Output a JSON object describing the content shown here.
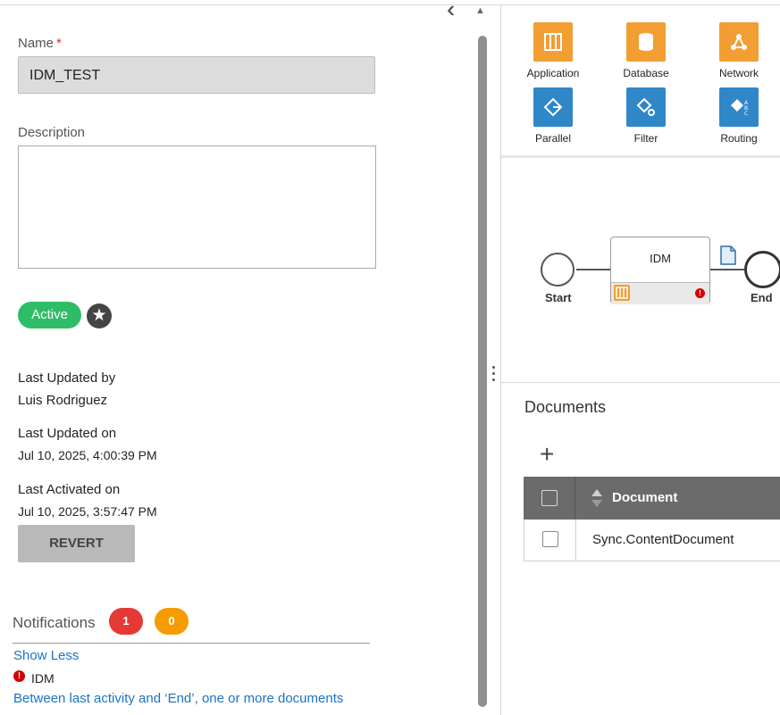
{
  "form": {
    "name_label": "Name",
    "required_mark": "*",
    "name_value": "IDM_TEST",
    "description_label": "Description",
    "description_value": "",
    "status": "Active",
    "last_updated_by_label": "Last Updated by",
    "last_updated_by": "Luis Rodriguez",
    "last_updated_on_label": "Last Updated on",
    "last_updated_on": "Jul 10, 2025, 4:00:39 PM",
    "last_activated_on_label": "Last Activated on",
    "last_activated_on": "Jul 10, 2025, 3:57:47 PM",
    "revert_label": "REVERT"
  },
  "notifications": {
    "title": "Notifications",
    "error_count": "1",
    "warning_count": "0",
    "show_less": "Show Less",
    "item_name": "IDM",
    "item_message": "Between last activity and ‘End’, one or more documents"
  },
  "palette": {
    "items": [
      {
        "label": "Application",
        "icon": "application-icon",
        "color": "#f29e33"
      },
      {
        "label": "Database",
        "icon": "database-icon",
        "color": "#f29e33"
      },
      {
        "label": "Network",
        "icon": "network-icon",
        "color": "#f29e33"
      },
      {
        "label": "Parallel",
        "icon": "parallel-icon",
        "color": "#2f87c8"
      },
      {
        "label": "Filter",
        "icon": "filter-icon",
        "color": "#2f87c8"
      },
      {
        "label": "Routing",
        "icon": "routing-icon",
        "color": "#2f87c8"
      }
    ]
  },
  "canvas": {
    "start_label": "Start",
    "activity_name": "IDM",
    "end_label": "End"
  },
  "documents": {
    "title": "Documents",
    "column": "Document",
    "rows": [
      "Sync.ContentDocument"
    ]
  },
  "colors": {
    "active": "#2dbd67",
    "error": "#e53935",
    "warning": "#f59c00",
    "link": "#1a73c6",
    "header": "#6b6b6b"
  }
}
